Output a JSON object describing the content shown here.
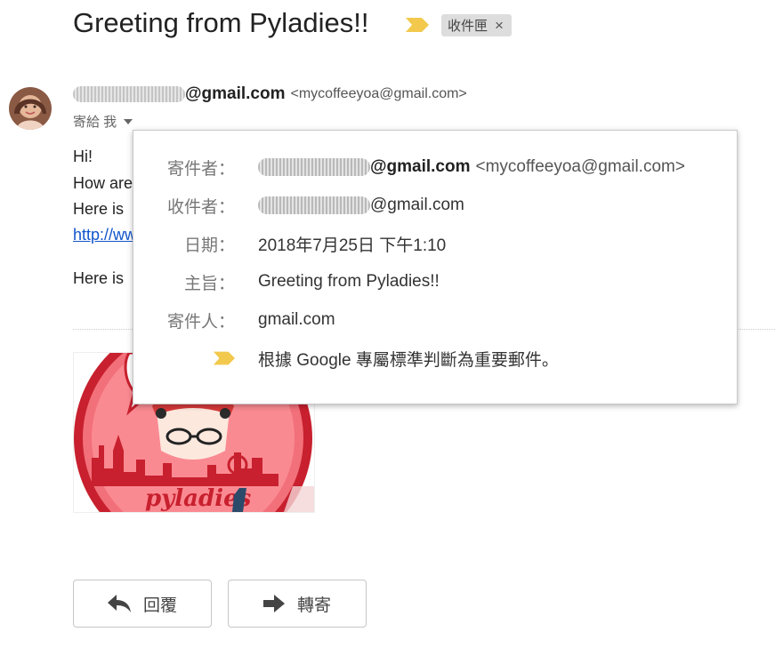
{
  "email": {
    "subject": "Greeting from Pyladies!!",
    "label_chip": "收件匣",
    "label_close": "×",
    "sender_domain": "@gmail.com",
    "sender_email": "<mycoffeeyoa@gmail.com>",
    "to_line": "寄給 我",
    "body_lines": [
      "Hi!",
      "How are",
      "Here is",
      "http://ww",
      "Here is"
    ]
  },
  "popup": {
    "rows": [
      {
        "label": "寄件者：",
        "domain": "@gmail.com",
        "email": "<mycoffeeyoa@gmail.com>"
      },
      {
        "label": "收件者：",
        "value": "@gmail.com"
      },
      {
        "label": "日期：",
        "value": "2018年7月25日 下午1:10"
      },
      {
        "label": "主旨：",
        "value": "Greeting from Pyladies!!"
      },
      {
        "label": "寄件人：",
        "value": "gmail.com"
      },
      {
        "label": "",
        "value": "根據 Google 專屬標準判斷為重要郵件。"
      }
    ],
    "colon": "："
  },
  "attachment": {
    "logo_text": "pyladies"
  },
  "actions": {
    "reply": "回覆",
    "forward": "轉寄"
  },
  "icons": {
    "importance": "important-marker-icon",
    "reply": "reply-arrow-icon",
    "forward": "forward-arrow-icon",
    "caret": "chevron-down-icon"
  },
  "colors": {
    "importance": "#f2c94c",
    "link": "#1155cc",
    "logo_red": "#c8202e"
  }
}
